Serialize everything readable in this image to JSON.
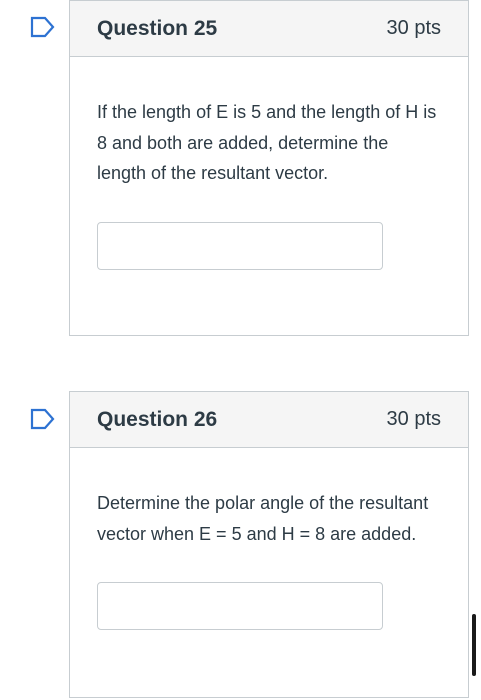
{
  "icons": {
    "flag": "flag-outline-icon",
    "flag_color": "#2d72d2"
  },
  "questions": [
    {
      "title": "Question 25",
      "points": "30 pts",
      "text": "If the length of E is 5  and the length of H is 8 and both are added, determine the length of the resultant vector.",
      "answer": ""
    },
    {
      "title": "Question 26",
      "points": "30 pts",
      "text": "Determine the polar angle of the resultant vector when E = 5 and H = 8  are added.",
      "answer": ""
    }
  ]
}
